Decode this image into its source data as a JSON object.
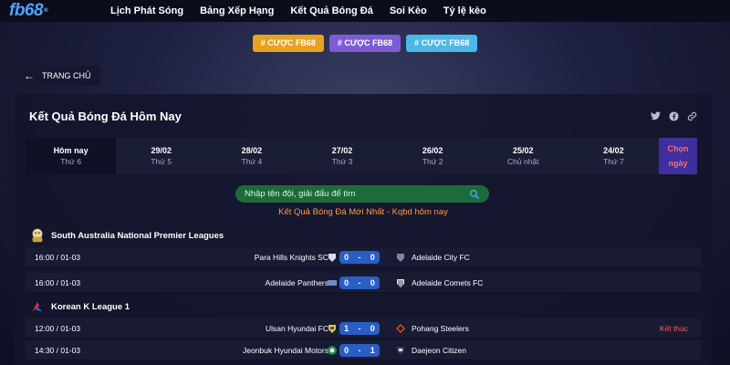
{
  "logo": {
    "text": "fb68",
    "mark": "®"
  },
  "nav": [
    "Lịch Phát Sóng",
    "Bảng Xếp Hạng",
    "Kết Quả Bóng Đá",
    "Soi Kèo",
    "Tỷ lệ kèo"
  ],
  "promos": [
    {
      "label": "# CƯỢC FB68",
      "color": "#e8a21f"
    },
    {
      "label": "# CƯỢC FB68",
      "color": "#7e5bd6"
    },
    {
      "label": "# CƯỢC FB68",
      "color": "#4cb8e8"
    }
  ],
  "back": {
    "label": "TRANG CHỦ"
  },
  "panel": {
    "title": "Kết Quả Bóng Đá Hôm Nay"
  },
  "share_icons": [
    "twitter-icon",
    "facebook-icon",
    "link-icon"
  ],
  "dates": [
    {
      "date": "Hôm nay",
      "day": "Thứ 6"
    },
    {
      "date": "29/02",
      "day": "Thứ 5"
    },
    {
      "date": "28/02",
      "day": "Thứ 4"
    },
    {
      "date": "27/02",
      "day": "Thứ 3"
    },
    {
      "date": "26/02",
      "day": "Thứ 2"
    },
    {
      "date": "25/02",
      "day": "Chủ nhật"
    },
    {
      "date": "24/02",
      "day": "Thứ 7"
    }
  ],
  "pick_date": {
    "line1": "Chọn",
    "line2": "ngày"
  },
  "search": {
    "placeholder": "Nhập tên đội, giải đấu để tìm"
  },
  "latest_heading": "Kết Quả Bóng Đá Mới Nhất - Kqbd hôm nay",
  "leagues": [
    {
      "name": "South Australia National Premier Leagues",
      "matches": [
        {
          "time": "16:00 / 01-03",
          "home": "Para Hills Knights SC",
          "home_goals": "0",
          "away_goals": "0",
          "away": "Adelaide City FC",
          "status": ""
        },
        {
          "time": "16:00 / 01-03",
          "home": "Adelaide Panthers",
          "home_goals": "0",
          "away_goals": "0",
          "away": "Adelaide Comets FC",
          "status": ""
        }
      ]
    },
    {
      "name": "Korean K League 1",
      "matches": [
        {
          "time": "12:00 / 01-03",
          "home": "Ulsan Hyundai FC",
          "home_goals": "1",
          "away_goals": "0",
          "away": "Pohang Steelers",
          "status": "Kết thúc"
        },
        {
          "time": "14:30 / 01-03",
          "home": "Jeonbuk Hyundai Motors",
          "home_goals": "0",
          "away_goals": "1",
          "away": "Daejeon Citizen",
          "status": ""
        }
      ]
    }
  ],
  "colors": {
    "score_bg": "#2b5ec4",
    "status": "#ff5a5a",
    "latest": "#ff9a3c",
    "search_bg": "#1d6b3a"
  }
}
